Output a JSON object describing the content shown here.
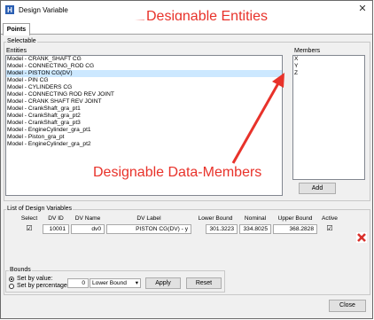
{
  "window": {
    "title": "Design Variable",
    "close_glyph": "✕"
  },
  "tabs": [
    {
      "label": "Points"
    }
  ],
  "annotations": {
    "entities": "Designable Entities",
    "members": "Designable Data-Members"
  },
  "selectable": {
    "group_label": "Selectable",
    "entities_label": "Entities",
    "members_label": "Members",
    "entities": [
      "Model - CRANK_SHAFT CG",
      "Model - CONNECTING_ROD CG",
      "Model - PISTON CG(DV)",
      "Model - PIN CG",
      "Model - CYLINDERS CG",
      "Model - CONNECTING ROD REV JOINT",
      "Model - CRANK SHAFT REV JOINT",
      "Model - CrankShaft_gra_pt1",
      "Model - CrankShaft_gra_pt2",
      "Model - CrankShaft_gra_pt3",
      "Model - EngineCylinder_gra_pt1",
      "Model - Piston_gra_pt",
      "Model - EngineCylinder_gra_pt2"
    ],
    "members": [
      "X",
      "Y",
      "Z"
    ],
    "add_label": "Add"
  },
  "design_vars": {
    "group_label": "List of Design Variables",
    "columns": [
      "Select",
      "DV ID",
      "DV Name",
      "DV Label",
      "Lower Bound",
      "Nominal",
      "Upper Bound",
      "Active"
    ],
    "rows": [
      {
        "select": "☑",
        "dv_id": "10001",
        "dv_name": "dv0",
        "dv_label": "PISTON CG(DV) - y",
        "lower": "301.3223",
        "nominal": "334.8025",
        "upper": "368.2828",
        "active": "☑"
      }
    ],
    "delete_icon": "delete-icon"
  },
  "bounds": {
    "group_label": "Bounds",
    "by_value_label": "Set by value:",
    "by_percentage_label": "Set by percentage:",
    "percentage_value": "0",
    "bound_select_value": "Lower Bound",
    "apply_label": "Apply",
    "reset_label": "Reset"
  },
  "footer": {
    "close_label": "Close"
  },
  "colors": {
    "callout": "#e8322a",
    "selected_row": "#cce8ff",
    "delete_red": "#d9302b"
  }
}
